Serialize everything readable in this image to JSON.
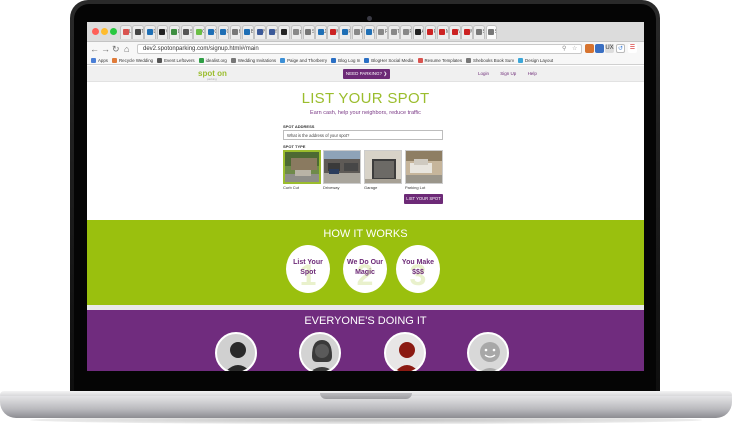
{
  "browser": {
    "tabs": [
      {
        "label": "Li",
        "color": "#d9534f"
      },
      {
        "label": "Te",
        "color": "#444444"
      },
      {
        "label": "D",
        "color": "#1f6fb5"
      },
      {
        "label": "Vi",
        "color": "#222222"
      },
      {
        "label": "Do",
        "color": "#3e8e41"
      },
      {
        "label": "Sk",
        "color": "#555555"
      },
      {
        "label": "O",
        "color": "#6bbe45"
      },
      {
        "label": "Ce",
        "color": "#1f6fb5"
      },
      {
        "label": "Ce",
        "color": "#1f6fb5"
      },
      {
        "label": "Hi",
        "color": "#777777"
      },
      {
        "label": "Bl",
        "color": "#1f6fb5"
      },
      {
        "label": "Ne",
        "color": "#3b5998"
      },
      {
        "label": "fa",
        "color": "#3b5998"
      },
      {
        "label": "",
        "color": "#222222"
      },
      {
        "label": "pi",
        "color": "#888888"
      },
      {
        "label": "Sk",
        "color": "#777777"
      },
      {
        "label": "Ja",
        "color": "#1f6fb5"
      },
      {
        "label": "M",
        "color": "#cc2222"
      },
      {
        "label": "Fr",
        "color": "#1f6fb5"
      },
      {
        "label": "Fr",
        "color": "#888888"
      },
      {
        "label": "Hi",
        "color": "#1f6fb5"
      },
      {
        "label": "Fr",
        "color": "#888888"
      },
      {
        "label": "Tr",
        "color": "#888888"
      },
      {
        "label": "Fr",
        "color": "#888888"
      },
      {
        "label": "Ar",
        "color": "#222222"
      },
      {
        "label": "Pi",
        "color": "#cc2222"
      },
      {
        "label": "M",
        "color": "#cc2222"
      },
      {
        "label": "Vi",
        "color": "#cc2222"
      },
      {
        "label": "M",
        "color": "#cc2222"
      },
      {
        "label": "Sk",
        "color": "#777777"
      },
      {
        "label": "Sk",
        "color": "#777777"
      }
    ],
    "url": "dev2.spotonparking.com/signup.html#/main",
    "bookmarks": [
      {
        "label": "Apps",
        "color": "#4a7fd6"
      },
      {
        "label": "Recycle Wedding",
        "color": "#e07b39"
      },
      {
        "label": "Event Leftovers",
        "color": "#555555"
      },
      {
        "label": "idealist.org",
        "color": "#2e9e44"
      },
      {
        "label": "Wedding Invitations",
        "color": "#777777"
      },
      {
        "label": "Paige and Thorberry",
        "color": "#3b8fd6"
      },
      {
        "label": "Blog Log In",
        "color": "#2a6fc4"
      },
      {
        "label": "BlogHer Social Media",
        "color": "#2a6fc4"
      },
      {
        "label": "Resume Templates",
        "color": "#d9534f"
      },
      {
        "label": "Shebooks Book Surv",
        "color": "#777777"
      },
      {
        "label": "Design Layout",
        "color": "#3ba6d8"
      }
    ]
  },
  "site": {
    "logo": "spot on",
    "logo_sub": "parking",
    "need_parking": "NEED PARKING?",
    "nav": [
      "Login",
      "Sign Up",
      "Help"
    ]
  },
  "list": {
    "title": "LIST YOUR SPOT",
    "subtitle": "Earn cash, help your neighbors, reduce traffic",
    "address_label": "SPOT ADDRESS",
    "address_placeholder": "What is the address of your spot?",
    "type_label": "SPOT TYPE",
    "types": [
      "Curb Cut",
      "Driveway",
      "Garage",
      "Parking Lot"
    ],
    "button": "LIST YOUR SPOT"
  },
  "how": {
    "title": "HOW IT WORKS",
    "steps": [
      {
        "num": "1",
        "line1": "List Your",
        "line2": "Spot"
      },
      {
        "num": "2",
        "line1": "We Do Our",
        "line2": "Magic"
      },
      {
        "num": "3",
        "line1": "You Make",
        "line2": "$$$"
      }
    ]
  },
  "everyone": {
    "title": "EVERYONE'S DOING IT"
  },
  "colors": {
    "green": "#9ac00e",
    "purple": "#702c7e",
    "title_green": "#9bbd2d"
  }
}
